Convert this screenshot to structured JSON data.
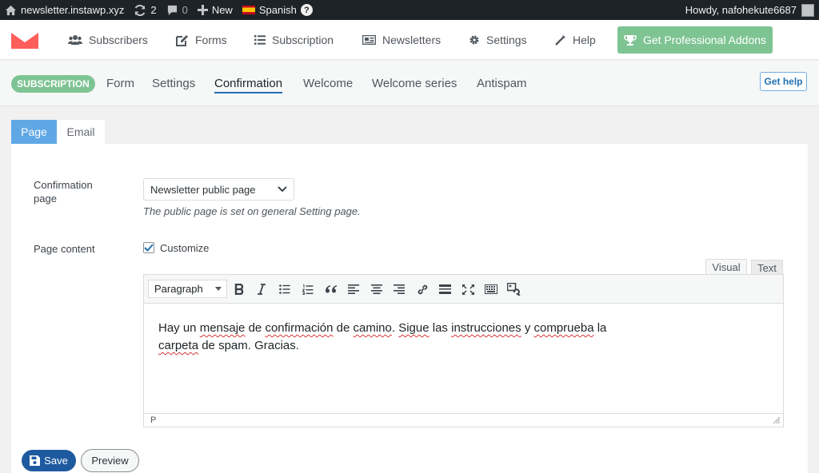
{
  "adminbar": {
    "site": "newsletter.instawp.xyz",
    "updates_count": "2",
    "comments_count": "0",
    "new_label": "New",
    "language": "Spanish",
    "help_glyph": "?",
    "greeting": "Howdy, nafohekute6687"
  },
  "mainnav": {
    "items": [
      {
        "label": "Subscribers",
        "icon": "users-icon"
      },
      {
        "label": "Forms",
        "icon": "edit-icon"
      },
      {
        "label": "Subscription",
        "icon": "list-icon"
      },
      {
        "label": "Newsletters",
        "icon": "newspaper-icon"
      },
      {
        "label": "Settings",
        "icon": "gear-icon"
      },
      {
        "label": "Help",
        "icon": "magic-wand-icon"
      }
    ],
    "pro_label": "Get Professional Addons"
  },
  "subnav": {
    "badge": "SUBSCRIPTION",
    "tabs": [
      "Form",
      "Settings",
      "Confirmation",
      "Welcome",
      "Welcome series",
      "Antispam"
    ],
    "active_tab": "Confirmation",
    "help_label": "Get help"
  },
  "page_tabs": [
    "Page",
    "Email"
  ],
  "form": {
    "confirmation_page_label": "Confirmation page",
    "confirmation_page_value": "Newsletter public page",
    "confirmation_page_hint": "The public page is set on general Setting page.",
    "page_content_label": "Page content",
    "customize_label": "Customize",
    "customize_checked": true
  },
  "editor": {
    "tab_visual": "Visual",
    "tab_text": "Text",
    "format_value": "Paragraph",
    "line1": {
      "t1": "Hay un ",
      "s1": "mensaje",
      "t2": " de ",
      "s2": "confirmación",
      "t3": " de ",
      "s3": "camino",
      "t4": ". ",
      "s4": "Sigue",
      "t5": " las ",
      "s5": "instrucciones",
      "t6": " y ",
      "s6": "comprueba",
      "t7": " la"
    },
    "line2": {
      "s1": "carpeta",
      "t1": " de spam. Gracias."
    },
    "path": "P"
  },
  "actions": {
    "save_label": "Save",
    "preview_label": "Preview"
  },
  "colors": {
    "accent_green": "#7ec493",
    "accent_blue": "#5fa8e5",
    "save_blue": "#1e5aa0",
    "logo_red": "#ff5e5b"
  }
}
